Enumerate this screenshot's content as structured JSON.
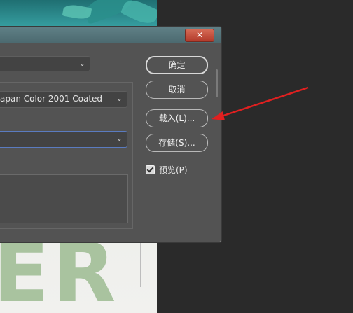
{
  "dialog": {
    "close_label": "✕",
    "fields": {
      "color_profile_value": "apan Color 2001 Coated",
      "top_select_value": "",
      "third_select_value": ""
    },
    "buttons": {
      "ok": "确定",
      "cancel": "取消",
      "load": "载入(L)...",
      "save": "存储(S)..."
    },
    "preview": {
      "label": "预览(P)",
      "checked": true
    }
  },
  "background": {
    "letters": "ER"
  },
  "colors": {
    "dialog_bg": "#535353",
    "annotation_arrow": "#e02020"
  },
  "icons": [
    "close-icon",
    "chevron-down-icon",
    "checkmark-icon",
    "arrow-annotation-icon"
  ]
}
